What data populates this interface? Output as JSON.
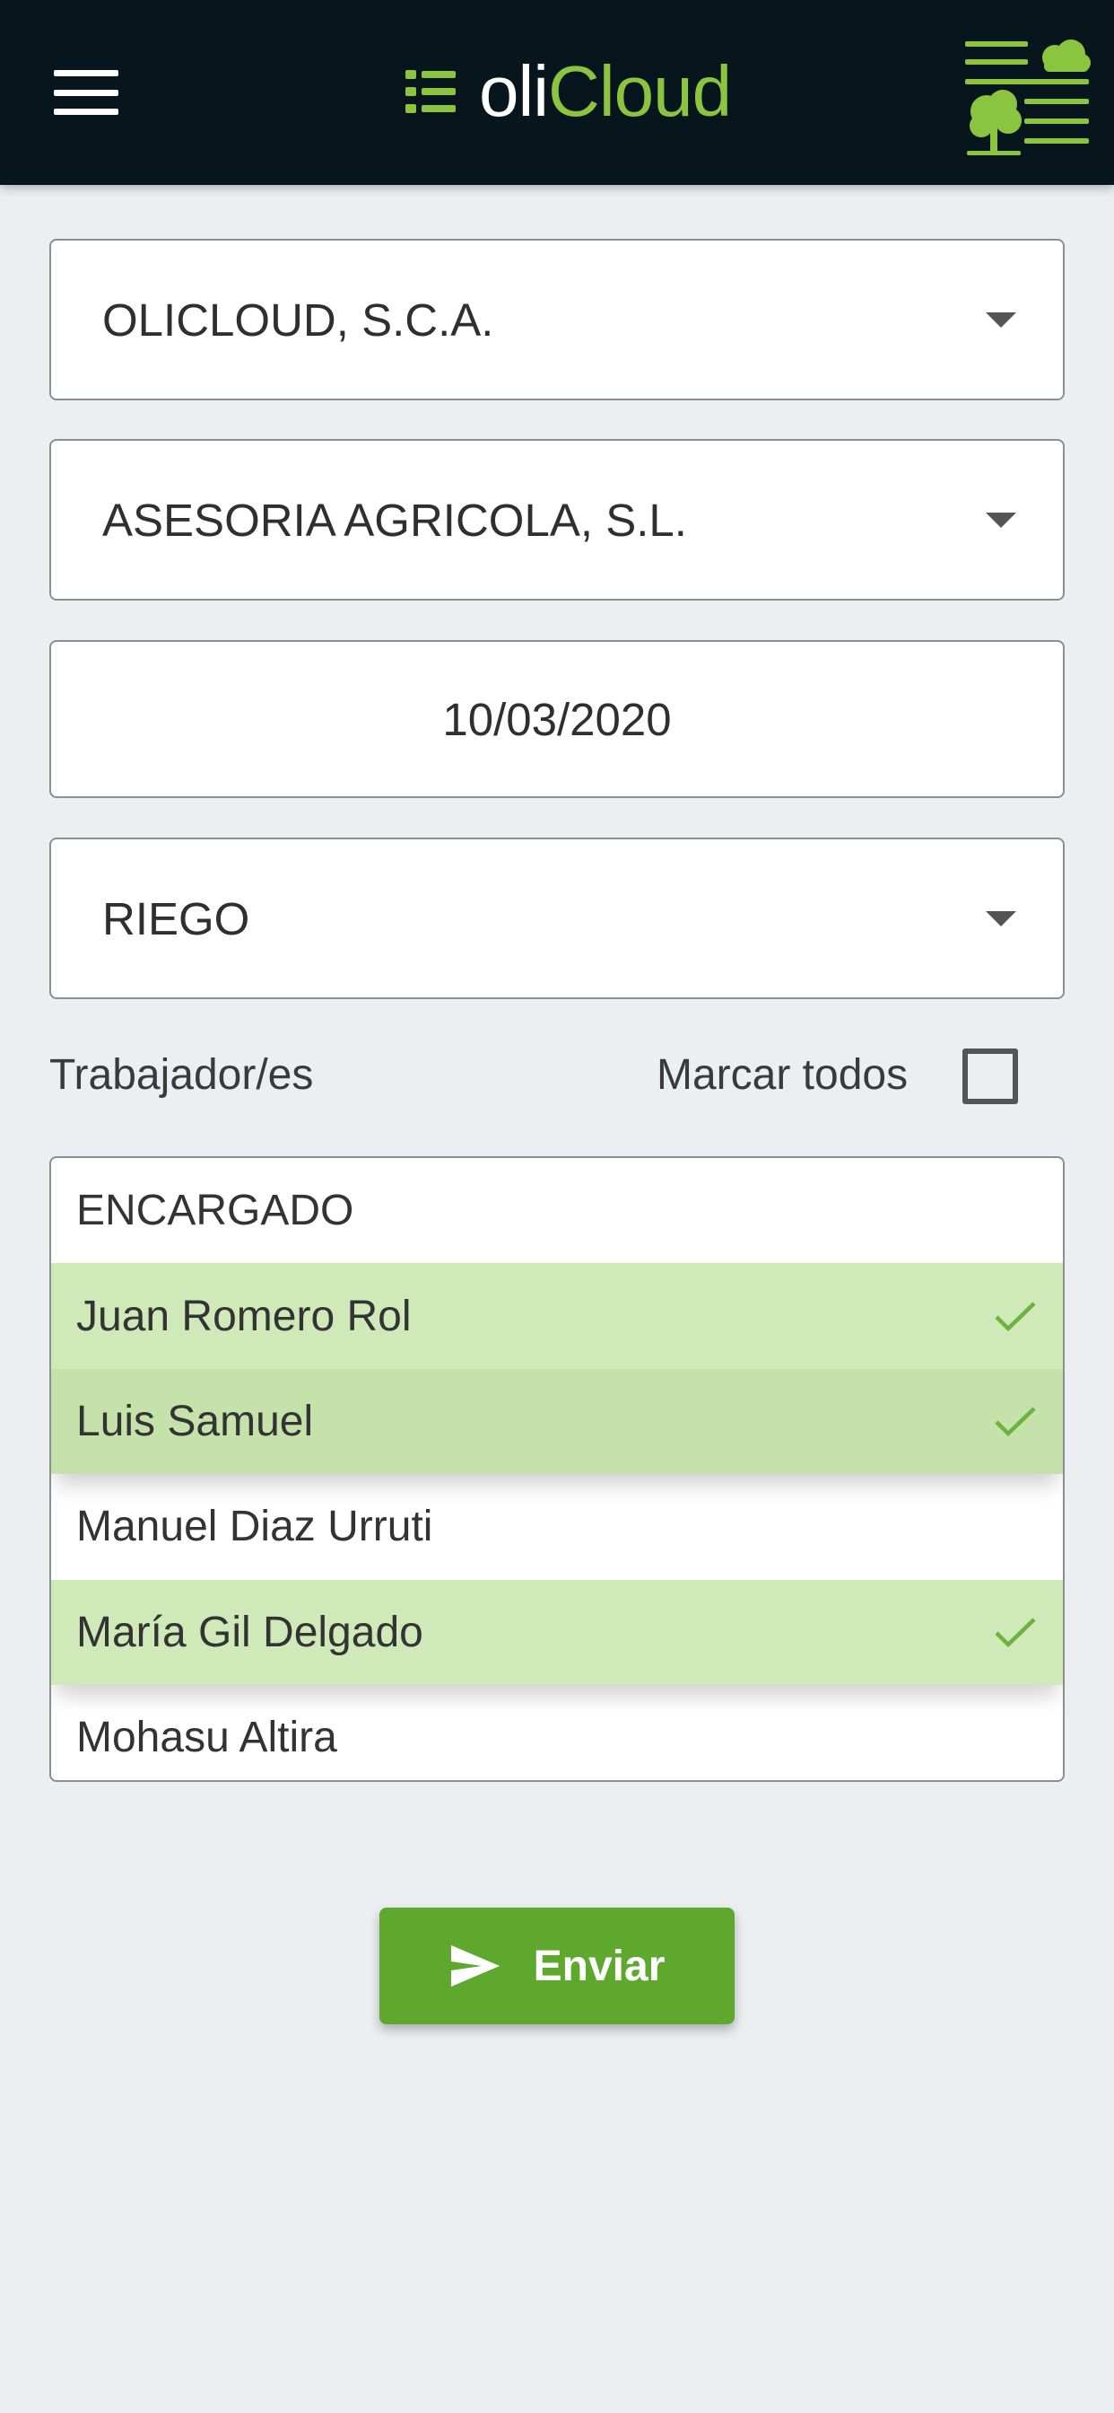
{
  "app": {
    "brand_prefix": "oli",
    "brand_suffix": "Cloud",
    "accent_color": "#8bc53f",
    "header_bg": "#07151c"
  },
  "form": {
    "company": "OLICLOUD, S.C.A.",
    "client": "ASESORIA AGRICOLA, S.L.",
    "date": "10/03/2020",
    "task": "RIEGO"
  },
  "workers": {
    "label": "Trabajador/es",
    "mark_all_label": "Marcar todos",
    "mark_all_checked": false,
    "items": [
      {
        "name": "ENCARGADO",
        "selected": false
      },
      {
        "name": "Juan Romero Rol",
        "selected": true
      },
      {
        "name": "Luis Samuel",
        "selected": true
      },
      {
        "name": "Manuel Diaz Urruti",
        "selected": false
      },
      {
        "name": "María Gil Delgado",
        "selected": true
      },
      {
        "name": "Mohasu Altira",
        "selected": false
      }
    ]
  },
  "actions": {
    "send_label": "Enviar",
    "send_icon": "send-icon",
    "send_color": "#5ea92d"
  }
}
